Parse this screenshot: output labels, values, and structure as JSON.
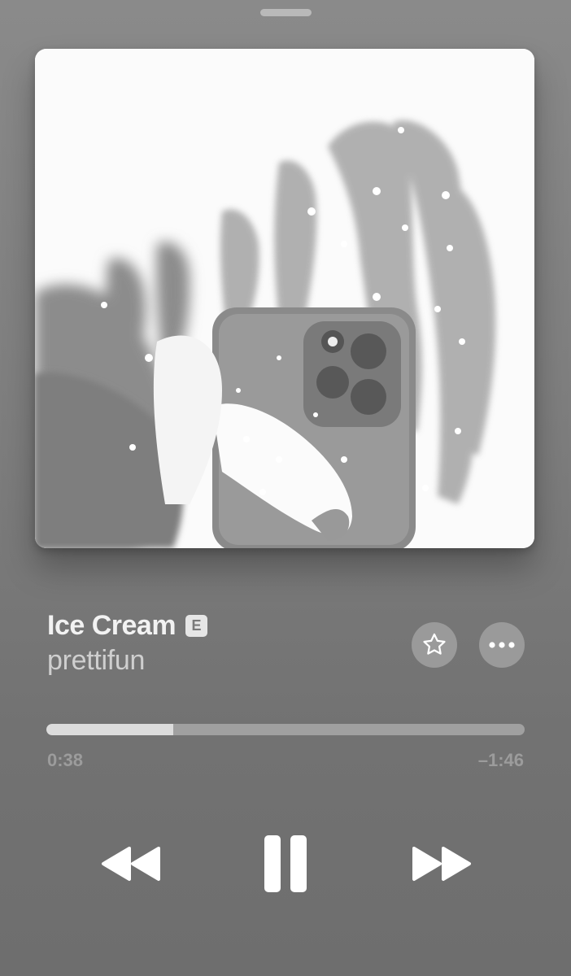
{
  "track": {
    "title": "Ice Cream",
    "explicit_badge": "E",
    "artist": "prettifun"
  },
  "actions": {
    "favorite_icon": "star-icon",
    "more_icon": "ellipsis-icon"
  },
  "playback": {
    "progress_fraction": 0.265,
    "elapsed": "0:38",
    "remaining": "–1:46",
    "state": "playing"
  },
  "controls": {
    "previous_icon": "rewind-icon",
    "play_pause_icon": "pause-icon",
    "next_icon": "fast-forward-icon"
  },
  "colors": {
    "background": "#7d7d7d",
    "progress_fill": "#dcdcdc",
    "progress_track": "#a0a0a0",
    "controls": "#ffffff"
  }
}
